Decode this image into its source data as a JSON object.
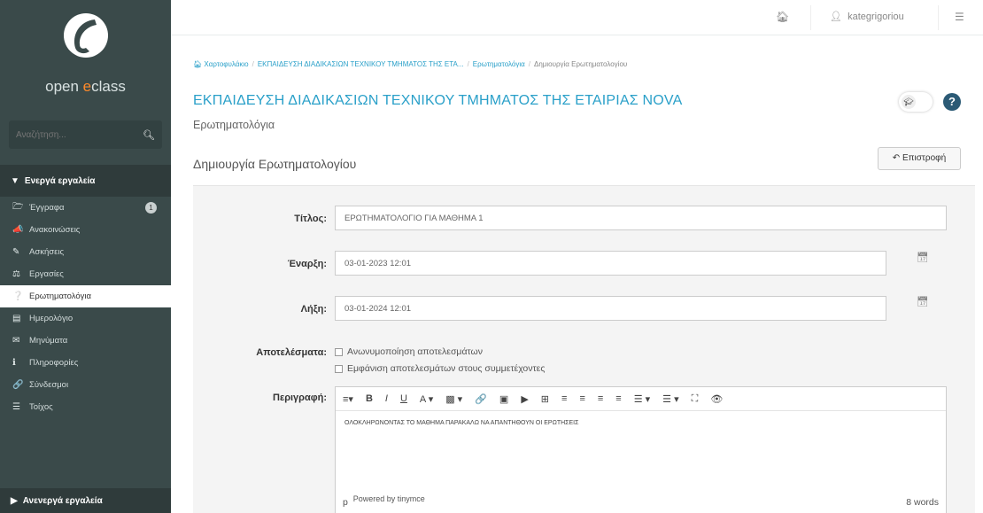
{
  "sidebar": {
    "brand_main": "open ",
    "brand_accent": "e",
    "brand_rest": "class",
    "search_placeholder": "Αναζήτηση...",
    "active_tools_header": "Ενεργά εργαλεία",
    "inactive_tools_header": "Ανενεργά εργαλεία",
    "items": [
      {
        "label": "Έγγραφα",
        "icon": "folder-icon",
        "badge": "1"
      },
      {
        "label": "Ανακοινώσεις",
        "icon": "bullhorn-icon"
      },
      {
        "label": "Ασκήσεις",
        "icon": "edit-icon"
      },
      {
        "label": "Εργασίες",
        "icon": "flask-icon"
      },
      {
        "label": "Ερωτηματολόγια",
        "icon": "question-circle-icon",
        "active": true
      },
      {
        "label": "Ημερολόγιο",
        "icon": "calendar-icon"
      },
      {
        "label": "Μηνύματα",
        "icon": "envelope-icon"
      },
      {
        "label": "Πληροφορίες",
        "icon": "info-icon"
      },
      {
        "label": "Σύνδεσμοι",
        "icon": "link-icon"
      },
      {
        "label": "Τοίχος",
        "icon": "list-icon"
      }
    ]
  },
  "topbar": {
    "username": "kategrigoriou"
  },
  "breadcrumb": {
    "items": [
      "Χαρτοφυλάκιο",
      "ΕΚΠΑΙΔΕΥΣΗ ΔΙΑΔΙΚΑΣΙΩΝ ΤΕΧΝΙΚΟΥ ΤΜΗΜΑΤΟΣ ΤΗΣ ΕΤΑ...",
      "Ερωτηματολόγια",
      "Δημιουργία Ερωτηματολογίου"
    ]
  },
  "course_title": "ΕΚΠΑΙΔΕΥΣΗ ΔΙΑΔΙΚΑΣΙΩΝ ΤΕΧΝΙΚΟΥ ΤΜΗΜΑΤΟΣ ΤΗΣ ΕΤΑΙΡΙΑΣ NOVA",
  "subtitle": "Ερωτηματολόγια",
  "page_heading": "Δημιουργία Ερωτηματολογίου",
  "back_label": "Επιστροφή",
  "form": {
    "title_label": "Τίτλος:",
    "title_value": "ΕΡΩΤΗΜΑΤΟΛΟΓΙΟ ΓΙΑ ΜΑΘΗΜΑ 1",
    "start_label": "Έναρξη:",
    "start_value": "03-01-2023 12:01",
    "end_label": "Λήξη:",
    "end_value": "03-01-2024 12:01",
    "results_label": "Αποτελέσματα:",
    "anon_label": "Ανωνυμοποίηση αποτελεσμάτων",
    "show_label": "Εμφάνιση αποτελεσμάτων στους συμμετέχοντες",
    "desc_label": "Περιγραφή:",
    "desc_value": "ΟΛΟΚΛΗΡΩΝΟΝΤΑΣ ΤΟ ΜΑΘΗΜΑ ΠΑΡΑΚΑΛΩ ΝΑ ΑΠΑΝΤΗΘΟΥΝ ΟΙ ΕΡΩΤΗΣΕΙΣ",
    "status_p": "p",
    "powered": "Powered by tinymce",
    "word_count": "8 words"
  },
  "colors": {
    "sidebar_bg": "#3a4a4a",
    "accent": "#2aa0c9",
    "brand_orange": "#ff8a2a"
  }
}
